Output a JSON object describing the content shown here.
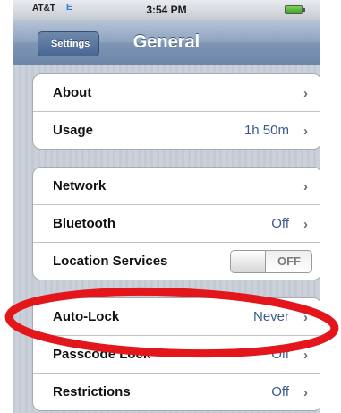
{
  "status_bar": {
    "carrier": "AT&T",
    "network": "E",
    "time": "3:54 PM"
  },
  "nav_bar": {
    "back_label": "Settings",
    "title": "General"
  },
  "groups": [
    {
      "rows": [
        {
          "label": "About",
          "value": ""
        },
        {
          "label": "Usage",
          "value": "1h 50m"
        }
      ]
    },
    {
      "rows": [
        {
          "label": "Network",
          "value": ""
        },
        {
          "label": "Bluetooth",
          "value": "Off"
        },
        {
          "label": "Location Services",
          "toggle": "OFF"
        }
      ]
    },
    {
      "rows": [
        {
          "label": "Auto-Lock",
          "value": "Never"
        },
        {
          "label": "Passcode Lock",
          "value": "Off"
        },
        {
          "label": "Restrictions",
          "value": "Off"
        }
      ]
    }
  ],
  "chevron": "›",
  "colors": {
    "annotation": "#e3161b",
    "value_text": "#3c5a8c",
    "nav_top": "#b7c4d6",
    "nav_bottom": "#6d86a9"
  }
}
